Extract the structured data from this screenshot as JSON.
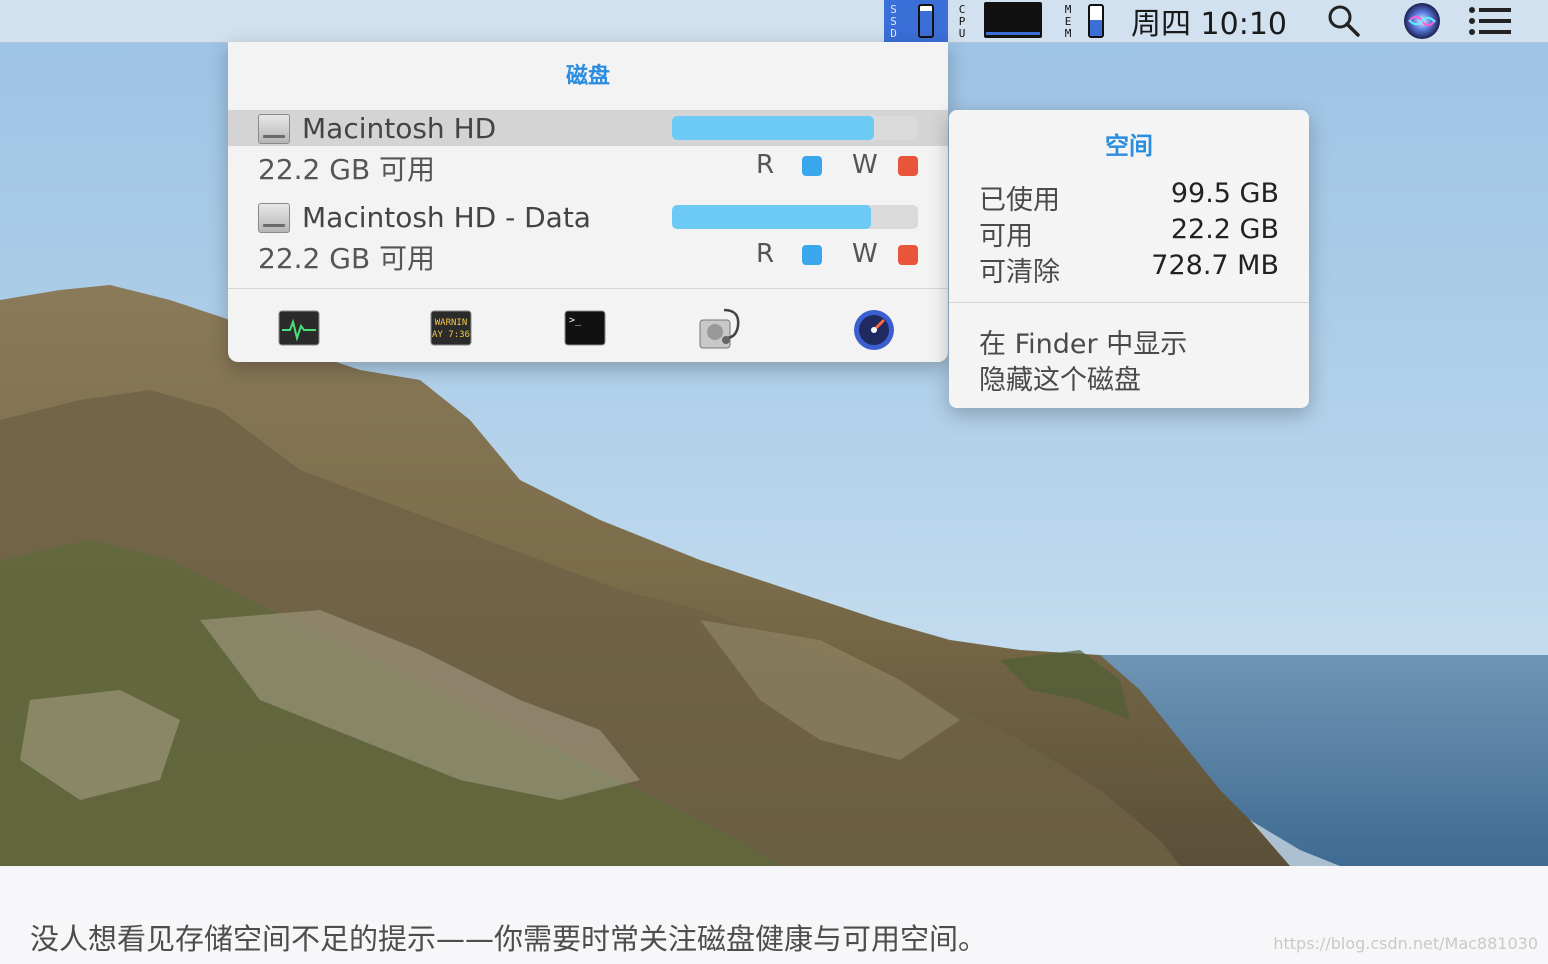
{
  "menubar": {
    "ssd_label": "SSD",
    "cpu_label": "CPU",
    "mem_label": "MEM",
    "clock": "周四 10:10",
    "ssd_usage_fraction": 0.82,
    "mem_usage_fraction": 0.55,
    "icons": [
      "disk-usage-gauge",
      "cpu-graph",
      "memory-gauge",
      "search-icon",
      "siri-icon",
      "notification-list-icon"
    ]
  },
  "disk_panel": {
    "title": "磁盘",
    "disks": [
      {
        "name": "Macintosh HD",
        "free": "22.2 GB 可用",
        "usage_fraction": 0.82,
        "read_label": "R",
        "write_label": "W"
      },
      {
        "name": "Macintosh HD - Data",
        "free": "22.2 GB 可用",
        "usage_fraction": 0.81,
        "read_label": "R",
        "write_label": "W"
      }
    ],
    "tools": [
      "activity-monitor-icon",
      "console-icon",
      "terminal-icon",
      "disk-utility-icon",
      "istat-menus-icon"
    ],
    "console_icon_text": "WARNIN\nAY 7:36"
  },
  "space_menu": {
    "title": "空间",
    "stats": [
      {
        "label": "已使用",
        "value": "99.5 GB"
      },
      {
        "label": "可用",
        "value": "22.2 GB"
      },
      {
        "label": "可清除",
        "value": "728.7 MB"
      }
    ],
    "actions": [
      "在 Finder 中显示",
      "隐藏这个磁盘"
    ]
  },
  "caption": "没人想看见存储空间不足的提示——你需要时常关注磁盘健康与可用空间。",
  "watermark": "https://blog.csdn.net/Mac881030",
  "colors": {
    "accent_blue": "#2a8de0",
    "usage_bar": "#6ccaf5",
    "read_indicator": "#3aa7ec",
    "write_indicator": "#e8553a",
    "ssd_highlight": "#3b6fd8"
  }
}
